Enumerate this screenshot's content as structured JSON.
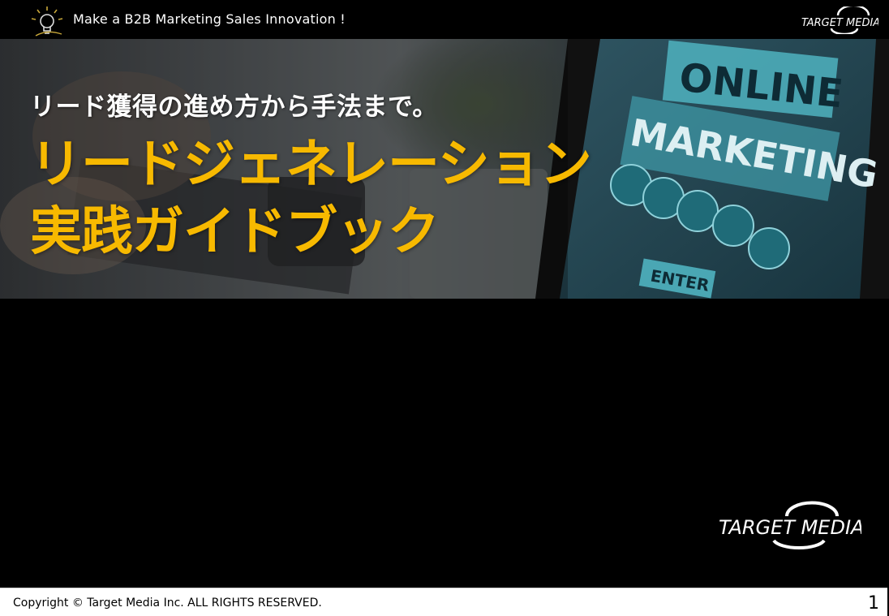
{
  "header": {
    "tagline": "Make a B2B Marketing Sales Innovation !",
    "logo_text": "TARGET MEDIA",
    "bulb_icon": "lightbulb-icon"
  },
  "hero": {
    "subtitle": "リード獲得の進め方から手法まで。",
    "title_line1": "リードジェネレーション",
    "title_line2": "実践ガイドブック",
    "image_text": {
      "line1": "ONLINE",
      "line2": "MARKETING",
      "button": "ENTER"
    },
    "title_color": "#f7b900"
  },
  "brand": {
    "logo_text": "TARGET MEDIA"
  },
  "footer": {
    "copyright": "Copyright © Target Media Inc. ALL RIGHTS RESERVED.",
    "page_number": "1"
  }
}
